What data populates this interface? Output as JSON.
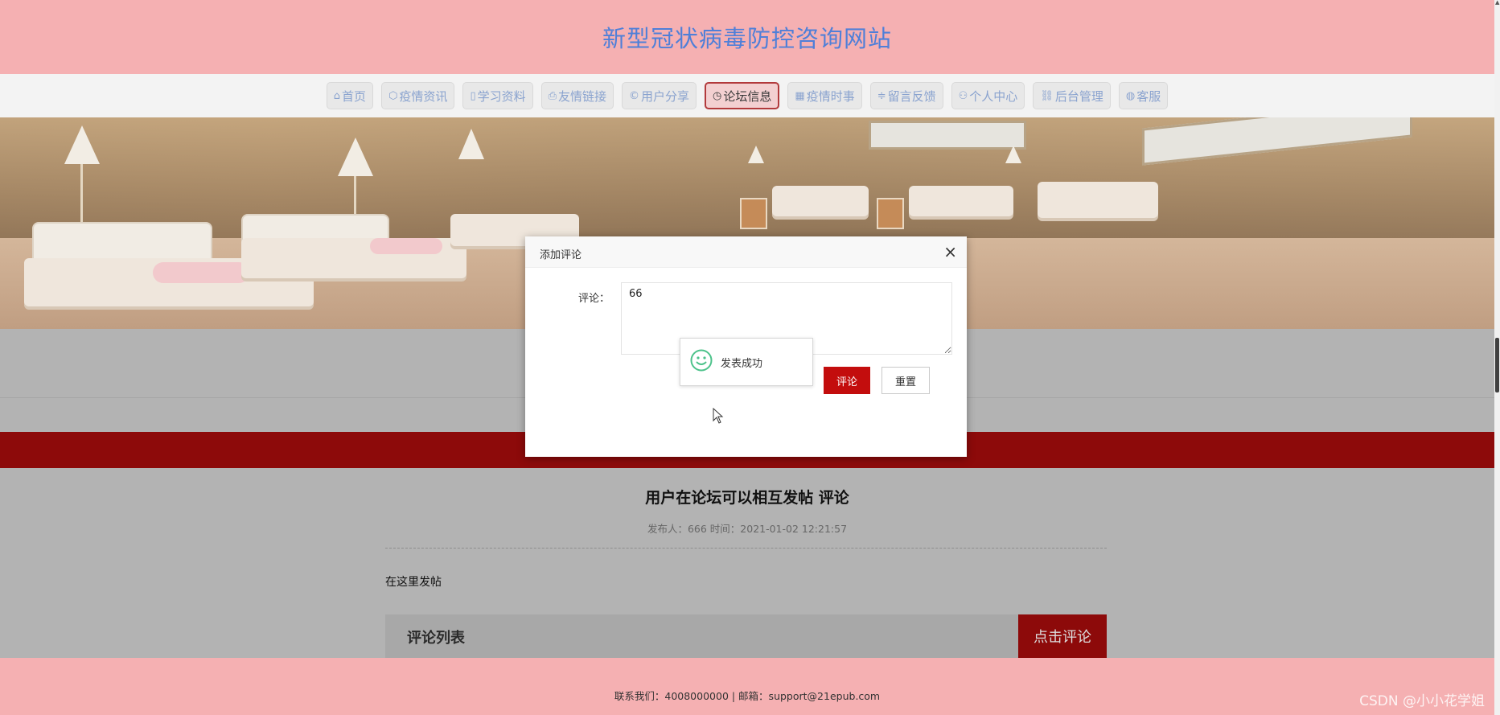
{
  "header": {
    "title": "新型冠状病毒防控咨询网站"
  },
  "nav": {
    "items": [
      {
        "icon": "home-icon",
        "glyph": "⌂",
        "label": "首页"
      },
      {
        "icon": "box-icon",
        "glyph": "⬡",
        "label": "疫情资讯"
      },
      {
        "icon": "book-icon",
        "glyph": "▯",
        "label": "学习资料"
      },
      {
        "icon": "printer-icon",
        "glyph": "⎙",
        "label": "友情链接"
      },
      {
        "icon": "copyright-icon",
        "glyph": "©",
        "label": "用户分享"
      },
      {
        "icon": "clock-icon",
        "glyph": "◷",
        "label": "论坛信息"
      },
      {
        "icon": "calendar-icon",
        "glyph": "▦",
        "label": "疫情时事"
      },
      {
        "icon": "sliders-icon",
        "glyph": "≑",
        "label": "留言反馈"
      },
      {
        "icon": "user-icon",
        "glyph": "⚇",
        "label": "个人中心"
      },
      {
        "icon": "link-icon",
        "glyph": "⛓",
        "label": "后台管理"
      },
      {
        "icon": "service-icon",
        "glyph": "◍",
        "label": "客服"
      }
    ],
    "active_index": 5
  },
  "post": {
    "title": "用户在论坛可以相互发帖 评论",
    "meta": "发布人：666 时间：2021-01-02 12:21:57",
    "body": "在这里发帖"
  },
  "comments": {
    "heading": "评论列表",
    "add_button": "点击评论"
  },
  "footer": {
    "text": "联系我们：4008000000 | 邮箱：support@21epub.com"
  },
  "watermark": "CSDN @小小花学姐",
  "modal": {
    "title": "添加评论",
    "close_glyph": "×",
    "field_label": "评论：",
    "comment_value": "66",
    "submit_label": "评论",
    "reset_label": "重置",
    "toast_text": "发表成功"
  },
  "colors": {
    "header_bg": "#f5b0b2",
    "title_blue": "#4f7fd8",
    "accent_red": "#c30d0d",
    "dark_red": "#8d0a0a",
    "success_green": "#4cc28a"
  }
}
